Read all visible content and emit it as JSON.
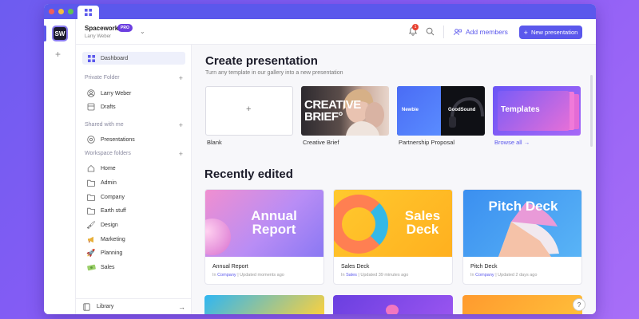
{
  "app": {
    "workspace_name": "Spacework",
    "plan_badge": "PRO",
    "user_name": "Larry Weber",
    "avatar_initials": "SW"
  },
  "header": {
    "notification_count": "1",
    "add_members_label": "Add members",
    "new_presentation_label": "New presentation"
  },
  "sidebar": {
    "dashboard_label": "Dashboard",
    "private_folder_title": "Private Folder",
    "private_items": [
      "Larry Weber",
      "Drafts"
    ],
    "shared_title": "Shared with me",
    "shared_items": [
      "Presentations"
    ],
    "workspace_title": "Workspace folders",
    "workspace_items": [
      "Home",
      "Admin",
      "Company",
      "Earth stuff",
      "Design",
      "Marketing",
      "Planning",
      "Sales"
    ],
    "library_label": "Library"
  },
  "create": {
    "title": "Create presentation",
    "subtitle": "Turn any template in our gallery into a new presentation",
    "templates": [
      {
        "label": "Blank"
      },
      {
        "label": "Creative Brief",
        "thumb_text": "CREATIVE BRIEF°"
      },
      {
        "label": "Partnership Proposal",
        "thumb_left": "Newbie",
        "thumb_right": "GoodSound"
      },
      {
        "label": "Browse all",
        "thumb_text": "Templates"
      }
    ]
  },
  "recent": {
    "title": "Recently edited",
    "cards": [
      {
        "thumb_title": "Annual Report",
        "name": "Annual Report",
        "in_label": "In",
        "folder": "Company",
        "updated": "Updated moments ago"
      },
      {
        "thumb_title": "Sales Deck",
        "name": "Sales Deck",
        "in_label": "In",
        "folder": "Sales",
        "updated": "Updated 39 minutes ago"
      },
      {
        "thumb_title": "Pitch Deck",
        "name": "Pitch Deck",
        "in_label": "In",
        "folder": "Company",
        "updated": "Updated 2 days ago"
      }
    ]
  },
  "colors": {
    "accent": "#5b58ec",
    "pro_badge": "#6c3fe0",
    "notification": "#e8402f"
  }
}
